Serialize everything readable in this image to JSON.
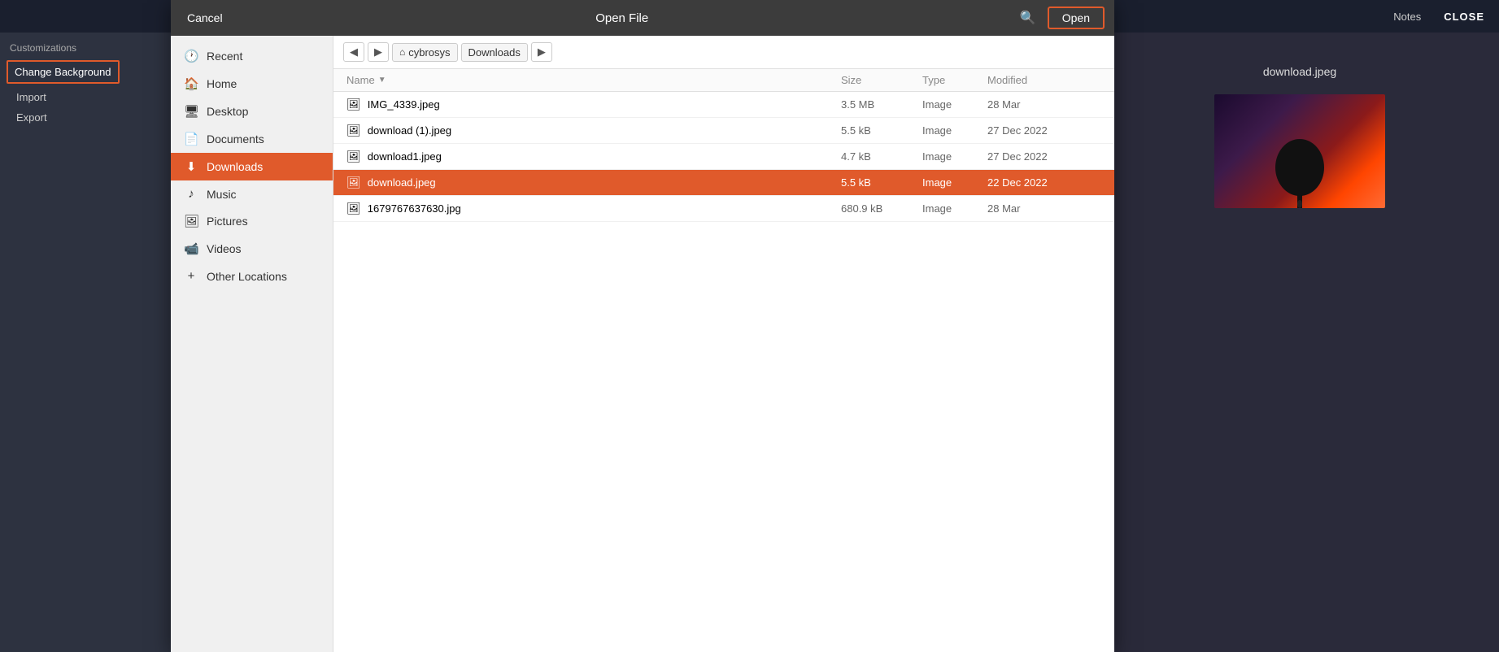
{
  "app": {
    "background_color": "#2d3240",
    "topbar": {
      "notes_label": "Notes",
      "close_label": "CLOSE"
    }
  },
  "customizations": {
    "title": "Customizations",
    "change_background_label": "Change Background",
    "import_label": "Import",
    "export_label": "Export"
  },
  "dialog": {
    "title": "Open File",
    "cancel_label": "Cancel",
    "open_label": "Open",
    "breadcrumb": {
      "back_icon": "◀",
      "forward_icon": "▶",
      "location_icon": "⌂",
      "location_name": "cybrosys",
      "current_folder": "Downloads"
    },
    "file_list": {
      "columns": {
        "name": "Name",
        "sort_icon": "▼",
        "size": "Size",
        "type": "Type",
        "modified": "Modified"
      },
      "files": [
        {
          "name": "IMG_4339.jpeg",
          "icon": "🖼",
          "size": "3.5 MB",
          "type": "Image",
          "modified": "28 Mar",
          "selected": false
        },
        {
          "name": "download (1).jpeg",
          "icon": "🖼",
          "size": "5.5 kB",
          "type": "Image",
          "modified": "27 Dec 2022",
          "selected": false
        },
        {
          "name": "download1.jpeg",
          "icon": "🖼",
          "size": "4.7 kB",
          "type": "Image",
          "modified": "27 Dec 2022",
          "selected": false
        },
        {
          "name": "download.jpeg",
          "icon": "🖼",
          "size": "5.5 kB",
          "type": "Image",
          "modified": "22 Dec 2022",
          "selected": true
        },
        {
          "name": "1679767637630.jpg",
          "icon": "🖼",
          "size": "680.9 kB",
          "type": "Image",
          "modified": "28 Mar",
          "selected": false
        }
      ]
    },
    "sidebar": {
      "items": [
        {
          "id": "recent",
          "icon": "🕐",
          "label": "Recent",
          "active": false
        },
        {
          "id": "home",
          "icon": "🏠",
          "label": "Home",
          "active": false
        },
        {
          "id": "desktop",
          "icon": "🖥",
          "label": "Desktop",
          "active": false
        },
        {
          "id": "documents",
          "icon": "📄",
          "label": "Documents",
          "active": false
        },
        {
          "id": "downloads",
          "icon": "⬇",
          "label": "Downloads",
          "active": true
        },
        {
          "id": "music",
          "icon": "♪",
          "label": "Music",
          "active": false
        },
        {
          "id": "pictures",
          "icon": "🖼",
          "label": "Pictures",
          "active": false
        },
        {
          "id": "videos",
          "icon": "📹",
          "label": "Videos",
          "active": false
        },
        {
          "id": "other-locations",
          "icon": "+",
          "label": "Other Locations",
          "active": false
        }
      ]
    }
  },
  "preview": {
    "filename": "download.jpeg"
  }
}
